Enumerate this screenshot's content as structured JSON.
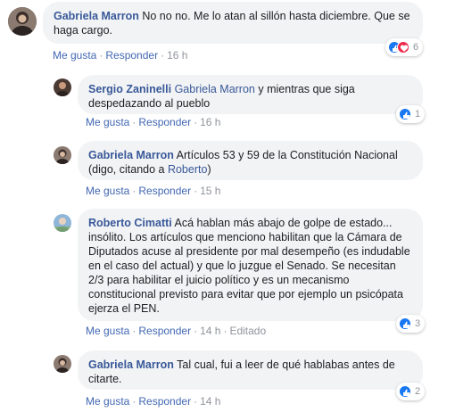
{
  "comments": [
    {
      "author": "Gabriela Marron",
      "text": "No no no. Me lo atan al sillón hasta diciembre. Que se haga cargo.",
      "mention": "",
      "like_label": "Me gusta",
      "reply_label": "Responder",
      "time": "16 h",
      "edited": "",
      "reactions": [
        "like-icon",
        "love-icon"
      ],
      "reaction_count": "6"
    },
    {
      "author": "Sergio Zaninelli",
      "mention": "Gabriela Marron",
      "text": "y mientras que siga despedazando al pueblo",
      "like_label": "Me gusta",
      "reply_label": "Responder",
      "time": "16 h",
      "edited": "",
      "reactions": [
        "like-icon"
      ],
      "reaction_count": "1"
    },
    {
      "author": "Gabriela Marron",
      "text_before": "Artículos 53 y 59 de la Constitución Nacional (digo, citando a ",
      "mention": "Roberto",
      "text_after": ")",
      "like_label": "Me gusta",
      "reply_label": "Responder",
      "time": "15 h",
      "edited": ""
    },
    {
      "author": "Roberto Cimatti",
      "text": "Acá hablan más abajo de golpe de estado... insólito. Los artículos que menciono habilitan que la Cámara de Diputados acuse al presidente por mal desempeño (es indudable en el caso del actual) y que lo juzgue el Senado. Se necesitan 2/3 para habilitar el juicio político y es un mecanismo constitucional previsto para evitar que por ejemplo un psicópata ejerza el PEN.",
      "like_label": "Me gusta",
      "reply_label": "Responder",
      "time": "14 h",
      "edited": "Editado",
      "reactions": [
        "like-icon"
      ],
      "reaction_count": "3"
    },
    {
      "author": "Gabriela Marron",
      "text": "Tal cual, fui a leer de qué hablabas antes de citarte.",
      "like_label": "Me gusta",
      "reply_label": "Responder",
      "time": "14 h",
      "edited": "",
      "reactions": [
        "like-icon"
      ],
      "reaction_count": "2"
    }
  ],
  "colors": {
    "link": "#385898",
    "bubble": "#f2f3f5",
    "action": "#4267b2",
    "like": "#1877f2",
    "love": "#f0284a"
  }
}
